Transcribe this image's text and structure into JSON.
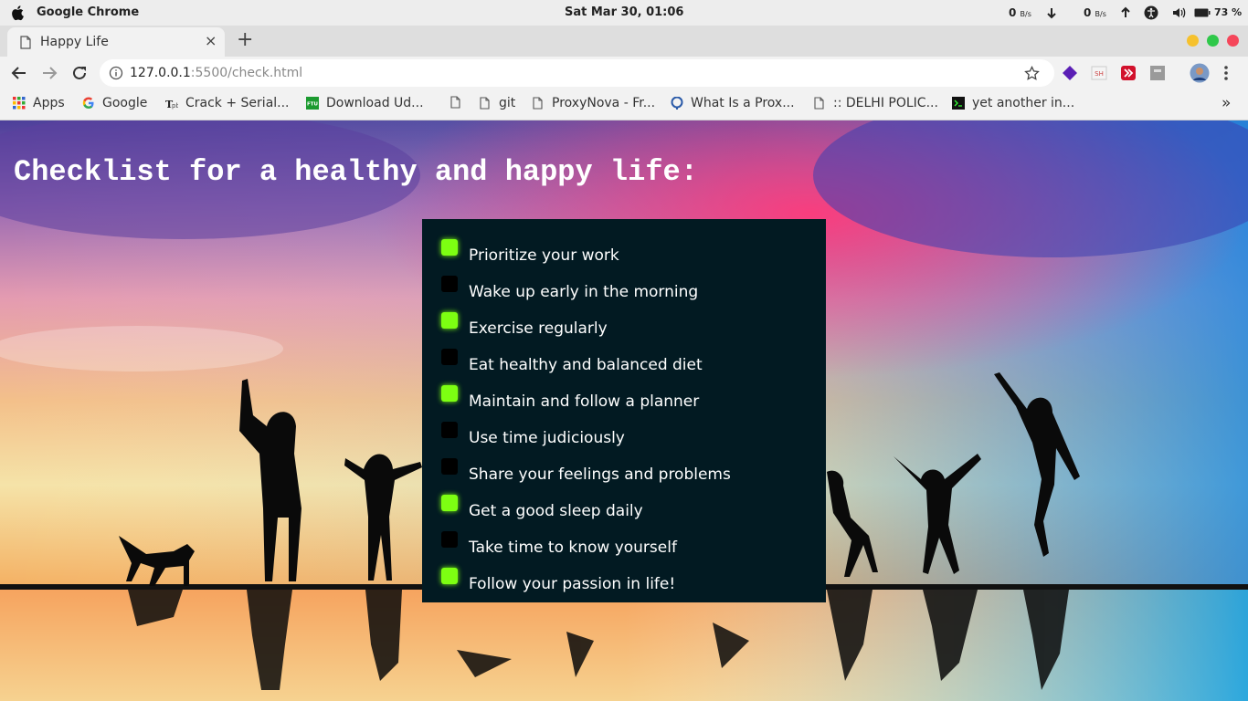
{
  "os": {
    "app_name": "Google Chrome",
    "clock": "Sat Mar 30, 01:06",
    "net_down_value": "0",
    "net_down_unit": "B/s",
    "net_up_value": "0",
    "net_up_unit": "B/s",
    "battery": "73 %"
  },
  "browser": {
    "tab_title": "Happy Life",
    "tab_close": "×",
    "new_tab": "+",
    "url_host": "127.0.0.1",
    "url_path": ":5500/check.html",
    "window_colors": {
      "minimize": "#f6c12d",
      "maximize": "#2fc84a",
      "close": "#f5465a"
    }
  },
  "bookmarks": [
    {
      "label": "Apps",
      "icon": "apps-grid-icon"
    },
    {
      "label": "Google",
      "icon": "google-icon"
    },
    {
      "label": "Crack + Serial...",
      "icon": "tpb-icon"
    },
    {
      "label": "Download Ud...",
      "icon": "ftu-icon"
    },
    {
      "label": "",
      "icon": "page-icon"
    },
    {
      "label": "git",
      "icon": "page-icon"
    },
    {
      "label": "ProxyNova - Fr...",
      "icon": "page-icon"
    },
    {
      "label": "What Is a Prox...",
      "icon": "proxy-icon"
    },
    {
      "label": ":: DELHI POLIC...",
      "icon": "page-icon"
    },
    {
      "label": "yet another in...",
      "icon": "terminal-icon"
    }
  ],
  "bookmarks_more": "»",
  "page": {
    "heading": "Checklist for a healthy and happy life:",
    "checklist": [
      {
        "label": "Prioritize your work",
        "checked": true
      },
      {
        "label": "Wake up early in the morning",
        "checked": false
      },
      {
        "label": "Exercise regularly",
        "checked": true
      },
      {
        "label": "Eat healthy and balanced diet",
        "checked": false
      },
      {
        "label": "Maintain and follow a planner",
        "checked": true
      },
      {
        "label": "Use time judiciously",
        "checked": false
      },
      {
        "label": "Share your feelings and problems",
        "checked": false
      },
      {
        "label": "Get a good sleep daily",
        "checked": true
      },
      {
        "label": "Take time to know yourself",
        "checked": false
      },
      {
        "label": "Follow your passion in life!",
        "checked": true
      }
    ],
    "colors": {
      "checked": "#7dff12",
      "panel": "#021a22"
    }
  }
}
